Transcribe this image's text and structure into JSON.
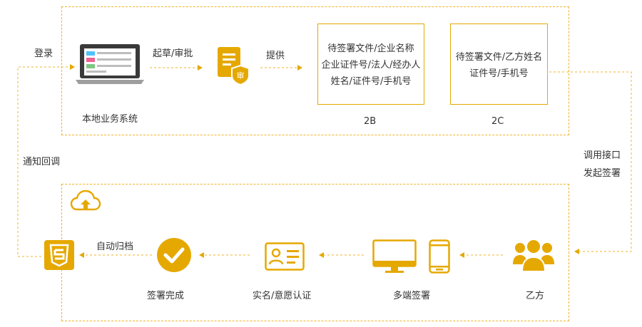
{
  "top_section": {
    "login_label": "登录",
    "draft_label": "起草/审批",
    "provide_label": "提供",
    "local_system_label": "本地业务系统",
    "box_2b": {
      "lines": [
        "待签署文件/企业名称",
        "企业证件号/法人/经办人",
        "姓名/证件号/手机号"
      ],
      "caption": "2B"
    },
    "box_2c": {
      "lines": [
        "待签署文件/乙方姓名",
        "证件号/手机号"
      ],
      "caption": "2C"
    }
  },
  "side_labels": {
    "notify_callback": "通知回调",
    "call_api_line1": "调用接口",
    "call_api_line2": "发起签署"
  },
  "bottom_section": {
    "auto_archive_label": "自动归档",
    "sign_complete_label": "签署完成",
    "verify_label": "实名/意愿认证",
    "multi_sign_label": "多端签署",
    "party_b_label": "乙方"
  },
  "colors": {
    "accent": "#e5a800",
    "dashed": "#f0b429"
  },
  "icons": [
    "laptop-icon",
    "audit-document-icon",
    "cloud-upload-icon",
    "archive-shield-icon",
    "check-circle-icon",
    "id-card-icon",
    "monitor-icon",
    "phone-icon",
    "users-icon"
  ]
}
